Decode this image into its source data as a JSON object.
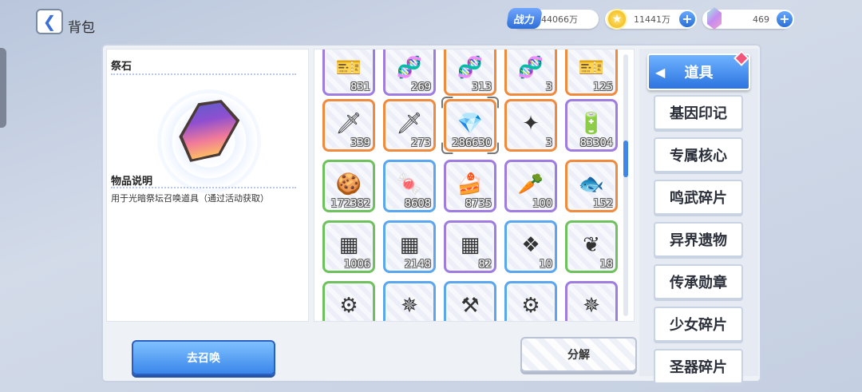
{
  "header": {
    "back_icon": "chevron-left-icon",
    "title": "背包",
    "power_label": "战力",
    "power_value": "44066万",
    "gold_value": "11441万",
    "crystal_value": "469",
    "plus": "+"
  },
  "detail": {
    "item_name": "祭石",
    "desc_heading": "物品说明",
    "desc_text": "用于光暗祭坛召唤道具（通过活动获取）"
  },
  "items": [
    {
      "count": "831",
      "rarity": "purple",
      "icon": "ticket-icon"
    },
    {
      "count": "269",
      "rarity": "purple",
      "icon": "dna-card-icon"
    },
    {
      "count": "313",
      "rarity": "orange",
      "icon": "dna-card-icon"
    },
    {
      "count": "3",
      "rarity": "orange",
      "icon": "dna-card-icon"
    },
    {
      "count": "125",
      "rarity": "orange",
      "icon": "ticket-icon"
    },
    {
      "count": "339",
      "rarity": "orange",
      "icon": "sword-card-icon"
    },
    {
      "count": "273",
      "rarity": "orange",
      "icon": "sword-card-icon"
    },
    {
      "count": "286630",
      "rarity": "orange",
      "icon": "crystal-icon",
      "selected": true
    },
    {
      "count": "3",
      "rarity": "orange",
      "icon": "star-card-icon"
    },
    {
      "count": "83304",
      "rarity": "purple",
      "icon": "battery-icon"
    },
    {
      "count": "172382",
      "rarity": "green",
      "icon": "cookie-icon"
    },
    {
      "count": "8608",
      "rarity": "blue",
      "icon": "candy-icon"
    },
    {
      "count": "8735",
      "rarity": "purple",
      "icon": "cake-icon"
    },
    {
      "count": "100",
      "rarity": "purple",
      "icon": "seed-bag-icon"
    },
    {
      "count": "152",
      "rarity": "orange",
      "icon": "fish-bag-icon"
    },
    {
      "count": "1006",
      "rarity": "green",
      "icon": "chip-icon"
    },
    {
      "count": "2148",
      "rarity": "blue",
      "icon": "chip-icon"
    },
    {
      "count": "82",
      "rarity": "purple",
      "icon": "chip-icon"
    },
    {
      "count": "10",
      "rarity": "blue",
      "icon": "crystal-cluster-icon"
    },
    {
      "count": "18",
      "rarity": "green",
      "icon": "feather-icon"
    },
    {
      "count": "",
      "rarity": "green",
      "icon": "gear-icon"
    },
    {
      "count": "",
      "rarity": "blue",
      "icon": "crystal-star-icon"
    },
    {
      "count": "",
      "rarity": "blue",
      "icon": "tool-icon"
    },
    {
      "count": "",
      "rarity": "blue",
      "icon": "gear-icon"
    },
    {
      "count": "",
      "rarity": "purple",
      "icon": "crystal-star-icon"
    }
  ],
  "categories": {
    "active": "道具",
    "list": [
      "基因印记",
      "专属核心",
      "鸣武碎片",
      "异界遗物",
      "传承勋章",
      "少女碎片",
      "圣器碎片"
    ]
  },
  "actions": {
    "summon": "去召唤",
    "decompose": "分解"
  }
}
